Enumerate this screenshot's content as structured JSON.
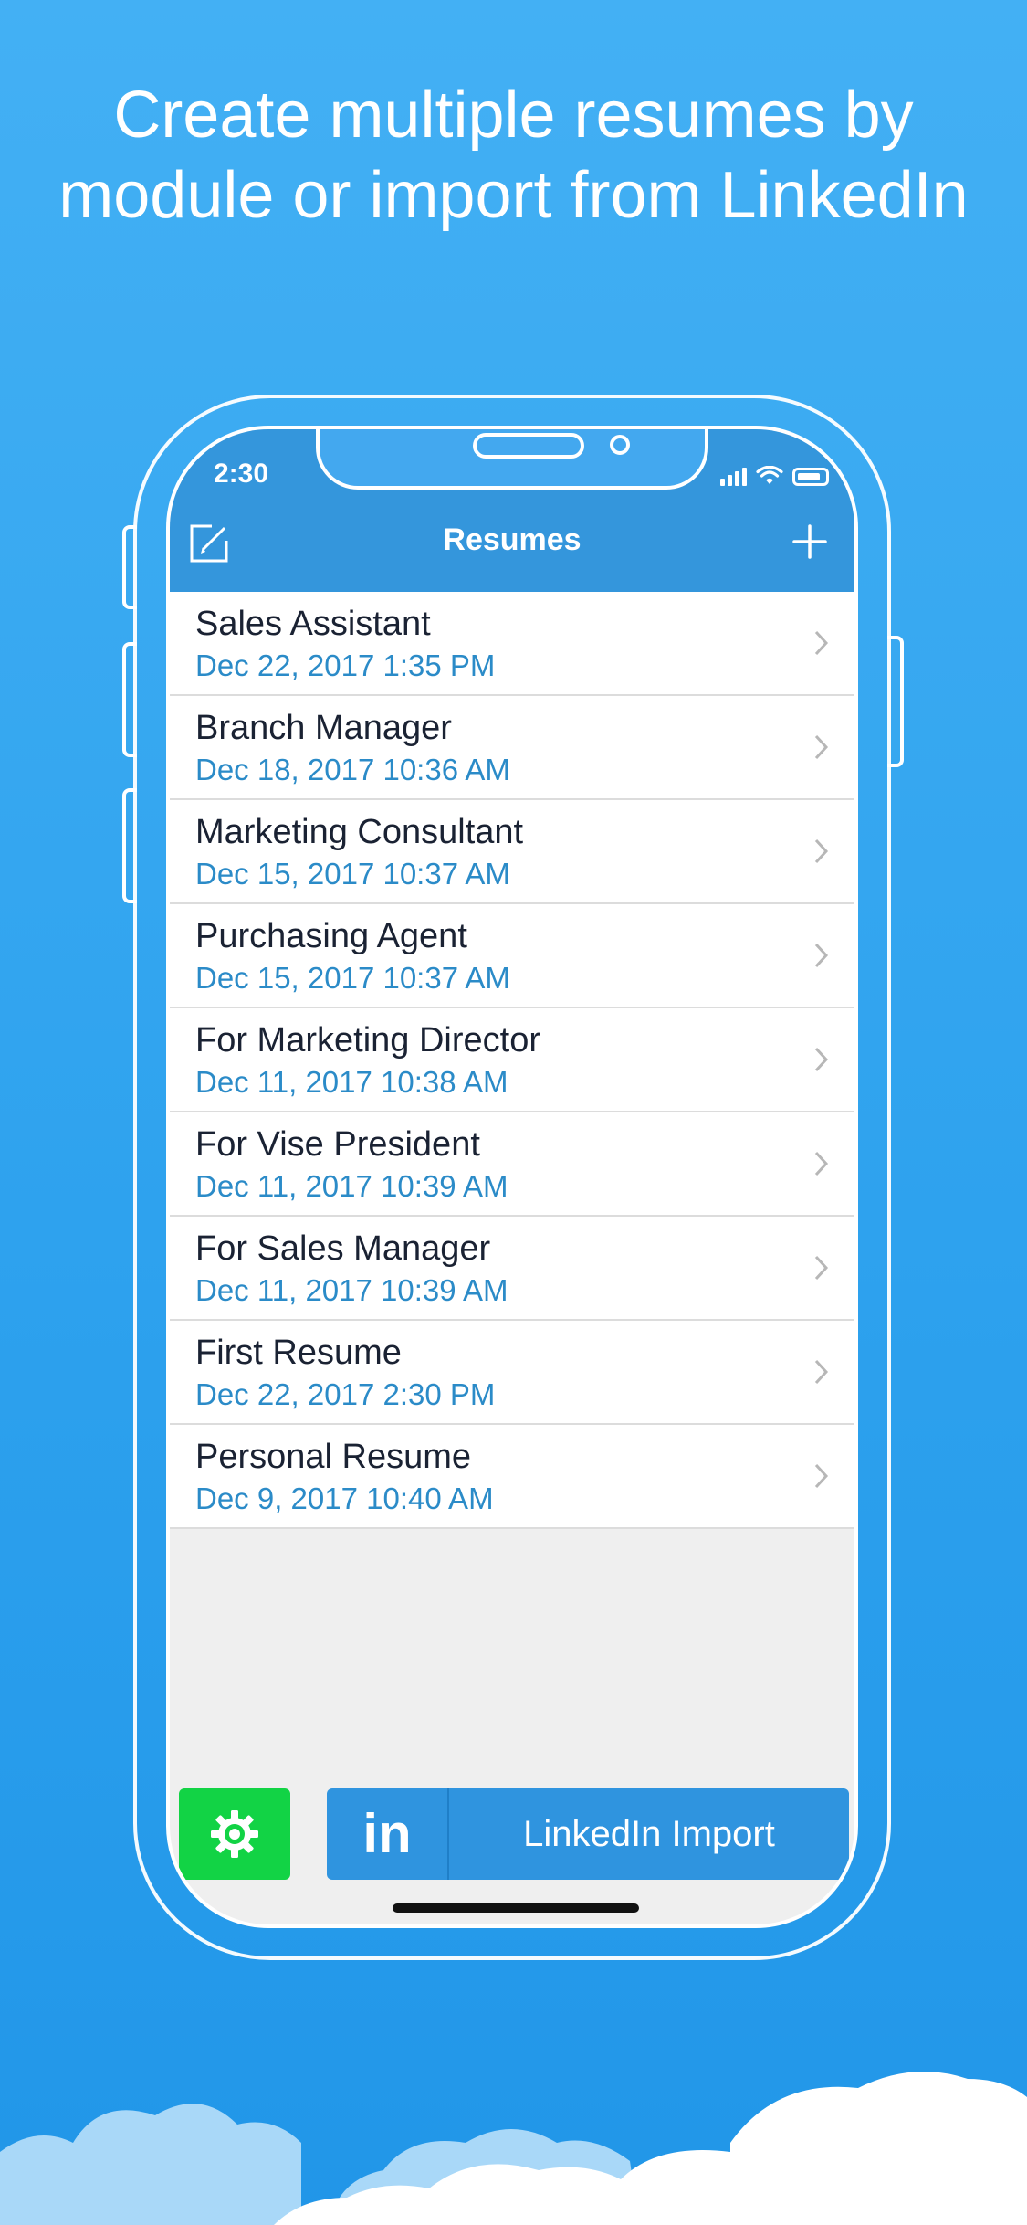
{
  "headline": {
    "line1": "Create multiple resumes by",
    "line2": "module or import from LinkedIn"
  },
  "status_bar": {
    "time": "2:30",
    "icons": [
      "signal-icon",
      "wifi-icon",
      "battery-icon"
    ]
  },
  "nav": {
    "title": "Resumes",
    "left_icon": "edit-icon",
    "right_icon": "plus-icon"
  },
  "resumes": [
    {
      "title": "Sales Assistant",
      "date": "Dec 22, 2017 1:35 PM"
    },
    {
      "title": "Branch Manager",
      "date": "Dec 18, 2017 10:36 AM"
    },
    {
      "title": "Marketing Consultant",
      "date": "Dec 15, 2017 10:37 AM"
    },
    {
      "title": "Purchasing Agent",
      "date": "Dec 15, 2017 10:37 AM"
    },
    {
      "title": "For Marketing Director",
      "date": "Dec 11, 2017 10:38 AM"
    },
    {
      "title": "For Vise President",
      "date": "Dec 11, 2017 10:39 AM"
    },
    {
      "title": "For Sales Manager",
      "date": "Dec 11, 2017 10:39 AM"
    },
    {
      "title": "First Resume",
      "date": "Dec 22, 2017 2:30 PM"
    },
    {
      "title": "Personal Resume",
      "date": "Dec 9, 2017 10:40 AM"
    }
  ],
  "bottom": {
    "settings_icon": "gear-icon",
    "linkedin_logo": "in",
    "linkedin_label": "LinkedIn Import"
  },
  "colors": {
    "background": "#2ea2ee",
    "nav_bar": "#3496dc",
    "date_text": "#2b8bc8",
    "settings_button": "#12d345",
    "linkedin_button": "#2f94df"
  }
}
